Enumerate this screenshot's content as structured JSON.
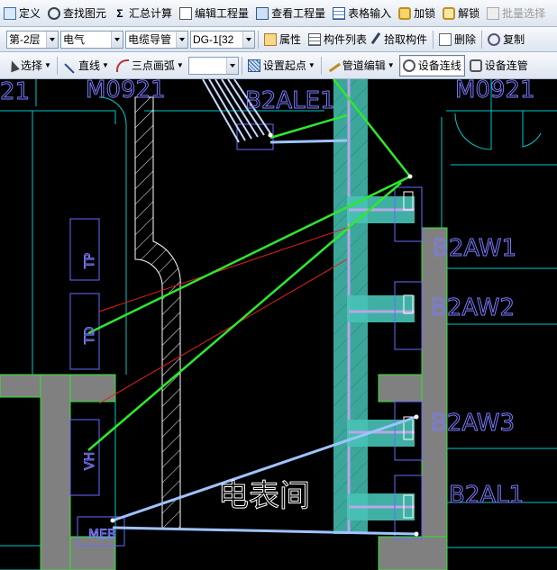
{
  "toolbar1": {
    "define": "定义",
    "find_element": "查找图元",
    "sum_calc": "汇总计算",
    "edit_quantity": "编辑工程量",
    "view_quantity": "查看工程量",
    "table_input": "表格输入",
    "lock": "加锁",
    "unlock": "解锁",
    "batch_select": "批量选择"
  },
  "toolbar2": {
    "floor": "第-2层",
    "discipline": "电气",
    "category": "电缆导管",
    "component": "DG-1[32",
    "properties": "属性",
    "component_list": "构件列表",
    "pick_component": "拾取构件",
    "delete": "删除",
    "copy": "复制"
  },
  "toolbar3": {
    "select": "选择",
    "line": "直线",
    "three_point_arc": "三点画弧",
    "blank_combo": "",
    "set_start": "设置起点",
    "pipe_edit": "管道编辑",
    "device_connect": "设备连线",
    "device_connect_pipe": "设备连管"
  },
  "drawing": {
    "door_left": "M0921",
    "door_right": "M0921",
    "door_edge": "21",
    "panel_b2ale1": "B2ALE1",
    "panel_b2aw1": "B2AW1",
    "panel_b2aw2": "B2AW2",
    "panel_b2aw3": "B2AW3",
    "panel_b2al1": "B2AL1",
    "room_name": "电表间",
    "box_tp": "TP",
    "box_td": "TD",
    "box_vh": "VH",
    "box_meb": "MEB"
  },
  "colors": {
    "background": "#000000",
    "wall": "#808080",
    "cad_line": "#00c8c8",
    "cable_green": "#2ee82e",
    "cable_blue": "#9fc3ff",
    "red_line": "#e02020",
    "label": "#8a8aff",
    "shaft": "#46c3b5"
  }
}
